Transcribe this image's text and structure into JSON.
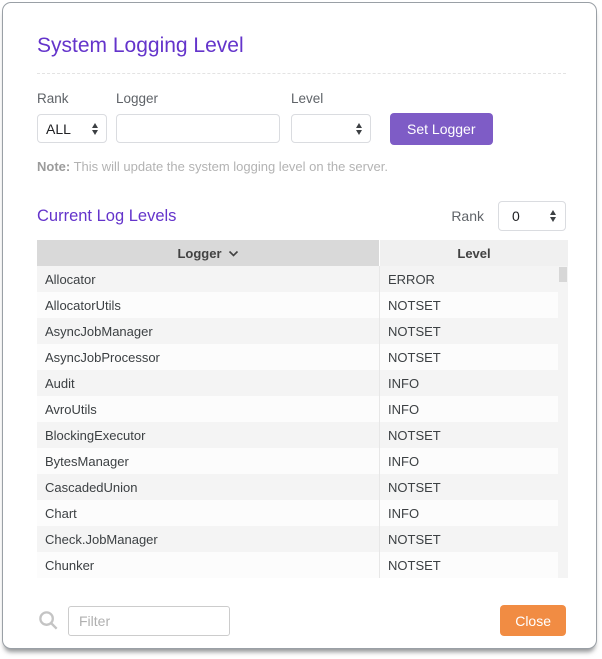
{
  "dialog": {
    "title": "System Logging Level",
    "form": {
      "rank_label": "Rank",
      "rank_value": "ALL",
      "logger_label": "Logger",
      "logger_value": "",
      "level_label": "Level",
      "level_value": "",
      "submit_label": "Set Logger"
    },
    "note": {
      "prefix": "Note:",
      "text": " This will update the system logging level on the server."
    },
    "current": {
      "heading": "Current Log Levels",
      "rank_label": "Rank",
      "rank_value": "0"
    },
    "table": {
      "columns": {
        "logger": "Logger",
        "level": "Level"
      },
      "rows": [
        {
          "logger": "Allocator",
          "level": "ERROR"
        },
        {
          "logger": "AllocatorUtils",
          "level": "NOTSET"
        },
        {
          "logger": "AsyncJobManager",
          "level": "NOTSET"
        },
        {
          "logger": "AsyncJobProcessor",
          "level": "NOTSET"
        },
        {
          "logger": "Audit",
          "level": "INFO"
        },
        {
          "logger": "AvroUtils",
          "level": "INFO"
        },
        {
          "logger": "BlockingExecutor",
          "level": "NOTSET"
        },
        {
          "logger": "BytesManager",
          "level": "INFO"
        },
        {
          "logger": "CascadedUnion",
          "level": "NOTSET"
        },
        {
          "logger": "Chart",
          "level": "INFO"
        },
        {
          "logger": "Check.JobManager",
          "level": "NOTSET"
        },
        {
          "logger": "Chunker",
          "level": "NOTSET"
        }
      ]
    },
    "footer": {
      "filter_placeholder": "Filter",
      "close_label": "Close"
    },
    "icons": {
      "search": "search-icon",
      "sort": "chevron-down-icon",
      "spinners": "select-spinner-icon"
    },
    "colors": {
      "accent_purple": "#6434cb",
      "button_purple": "#7e5cc6",
      "close_orange": "#f18c43",
      "header_dark": "#d9d9d9",
      "header_light": "#f0f0f0"
    }
  }
}
